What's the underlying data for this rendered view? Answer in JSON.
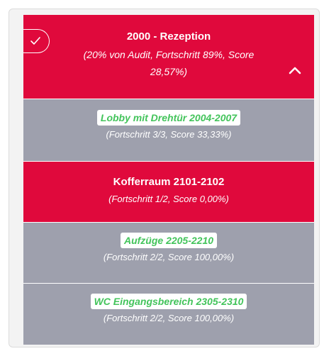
{
  "section": {
    "title": "2000 - Rezeption",
    "subtitle": "(20% von Audit, Fortschritt 89%, Score 28,57%)",
    "icons": {
      "check": "checkmark-icon",
      "collapse": "chevron-up-icon"
    },
    "colors": {
      "failed": "#e0093c",
      "passed": "#9ea0ad",
      "link": "#43c45b"
    }
  },
  "items": [
    {
      "title": "Lobby mit Drehtür 2004-2007",
      "detail": "(Fortschritt 3/3, Score 33,33%)"
    },
    {
      "title": "Kofferraum 2101-2102",
      "detail": "(Fortschritt 1/2, Score 0,00%)"
    },
    {
      "title": "Aufzüge 2205-2210",
      "detail": "(Fortschritt 2/2, Score 100,00%)"
    },
    {
      "title": "WC Eingangsbereich 2305-2310",
      "detail": "(Fortschritt 2/2, Score 100,00%)"
    }
  ]
}
